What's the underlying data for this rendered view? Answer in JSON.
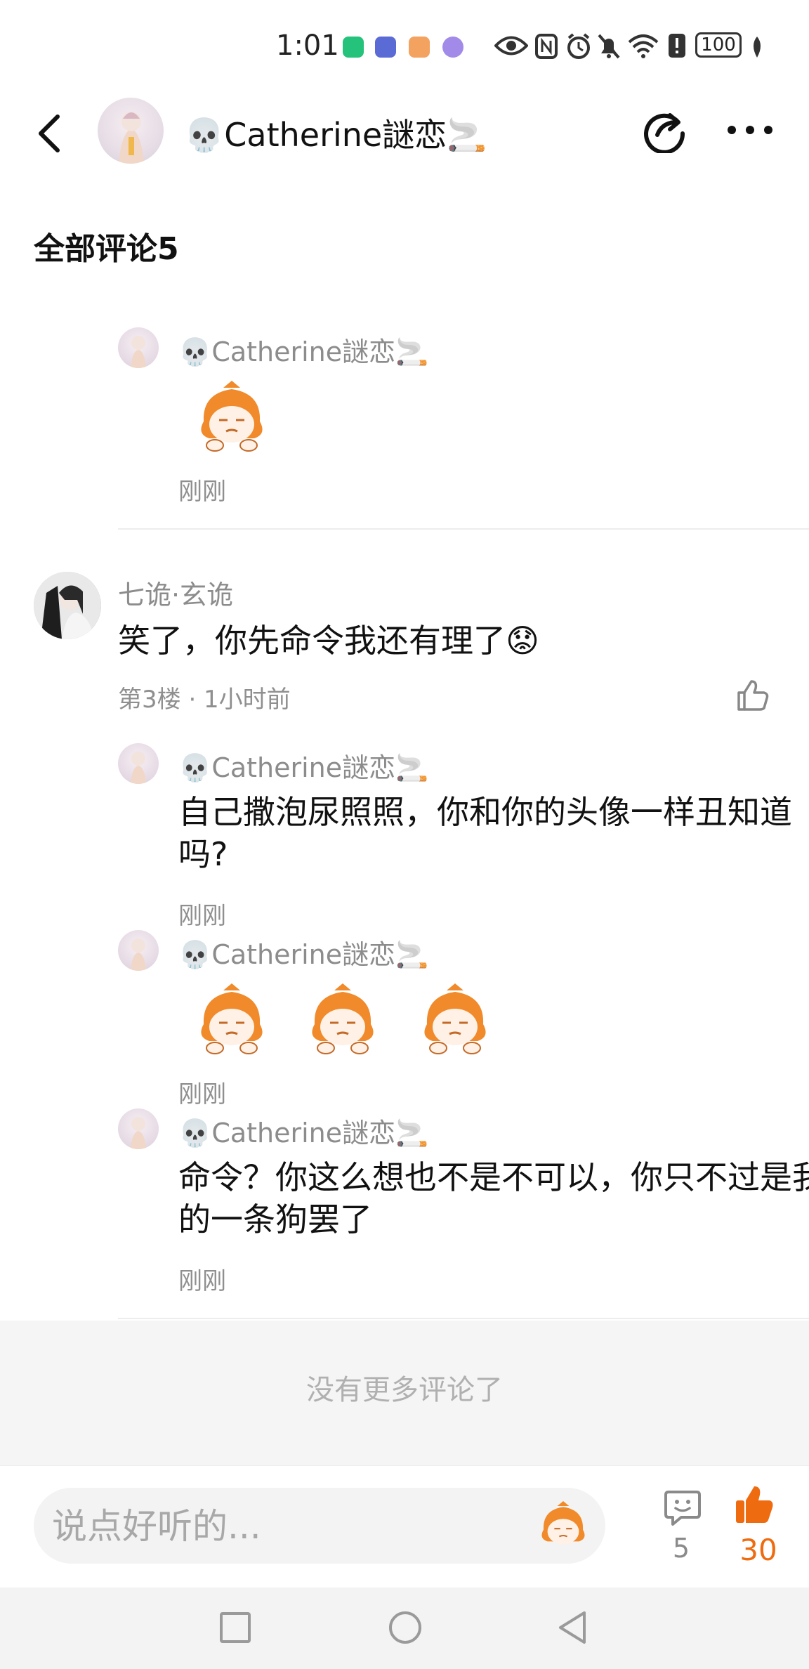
{
  "status_bar": {
    "time": "1:01",
    "battery": "100",
    "icons": [
      "hourglass-app-icon",
      "app-icon",
      "heart-app-icon",
      "purple-app-icon",
      "eye-icon",
      "nfc-icon",
      "alarm-icon",
      "mute-icon",
      "wifi-icon",
      "alert-icon",
      "battery-icon",
      "leaf-icon"
    ]
  },
  "header": {
    "user_name": "💀Catherine謎恋🚬",
    "icons": {
      "back": "back-arrow-icon",
      "share": "share-icon",
      "more": "more-icon"
    }
  },
  "section_title": "全部评论5",
  "replies_top": [
    {
      "name": "💀Catherine謎恋🚬",
      "content_type": "sticker",
      "time": "刚刚"
    }
  ],
  "floor": {
    "name": "七诡·玄诡",
    "text": "笑了，你先命令我还有理了😟",
    "meta": "第3楼 · 1小时前",
    "like_icon": "thumb-up-outline-icon",
    "replies": [
      {
        "name": "💀Catherine謎恋🚬",
        "text": "自己撒泡尿照照，你和你的头像一样丑知道吗?",
        "time": "刚刚"
      },
      {
        "name": "💀Catherine謎恋🚬",
        "content_type": "stickers",
        "sticker_count": 3,
        "time": "刚刚"
      },
      {
        "name": "💀Catherine謎恋🚬",
        "text": "命令？你这么想也不是不可以，你只不过是我的一条狗罢了",
        "time": "刚刚"
      }
    ]
  },
  "no_more": "没有更多评论了",
  "bottom_bar": {
    "placeholder": "说点好听的...",
    "comment_count": "5",
    "like_count": "30",
    "accent_color": "#ef6b10"
  },
  "nav_bar": {
    "icons": [
      "recent-apps-icon",
      "home-icon",
      "back-triangle-icon"
    ]
  }
}
